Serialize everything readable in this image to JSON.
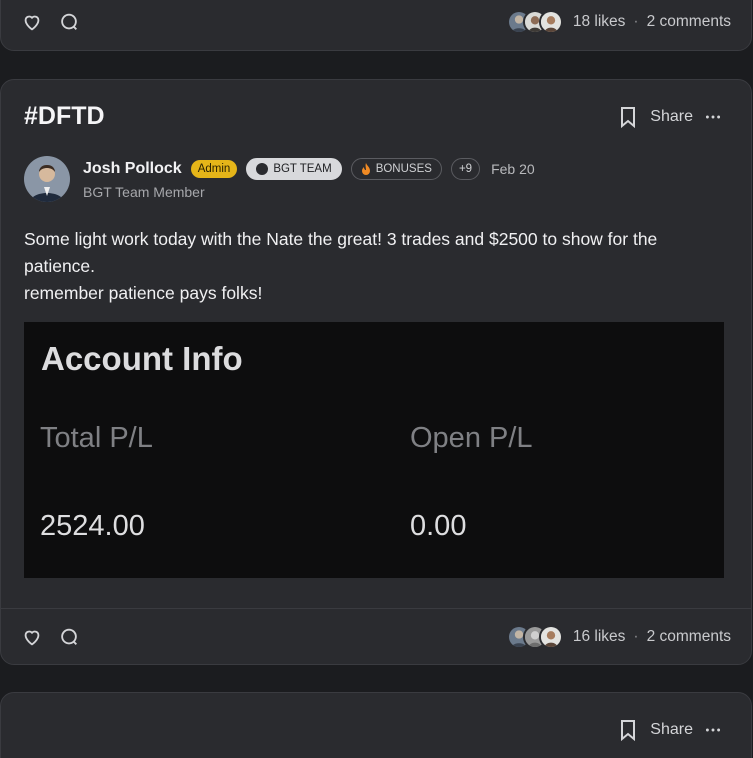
{
  "prev_post": {
    "likes": "18 likes",
    "comments": "2 comments"
  },
  "post": {
    "title": "#DFTD",
    "share_label": "Share",
    "author": {
      "name": "Josh Pollock",
      "badge": "Admin",
      "role": "BGT Team Member"
    },
    "chips": [
      "BGT TEAM",
      "BONUSES"
    ],
    "more_chips": "+9",
    "date": "Feb 20",
    "body_lines": [
      "Some light work today with the Nate the great!  3 trades and $2500 to show for the patience.",
      "remember patience pays folks!"
    ],
    "screenshot": {
      "title": "Account Info",
      "total_label": "Total P/L",
      "open_label": "Open P/L",
      "total_value": "2524.00",
      "open_value": "0.00"
    },
    "likes": "16 likes",
    "comments": "2 comments"
  },
  "next_post": {
    "share_label": "Share"
  },
  "colors": {
    "background": "#1b1c1f",
    "card": "#2a2b2f",
    "admin_badge": "#e5b519"
  },
  "icons": [
    "heart-icon",
    "comment-icon",
    "bookmark-icon",
    "more-icon",
    "flame-icon"
  ]
}
